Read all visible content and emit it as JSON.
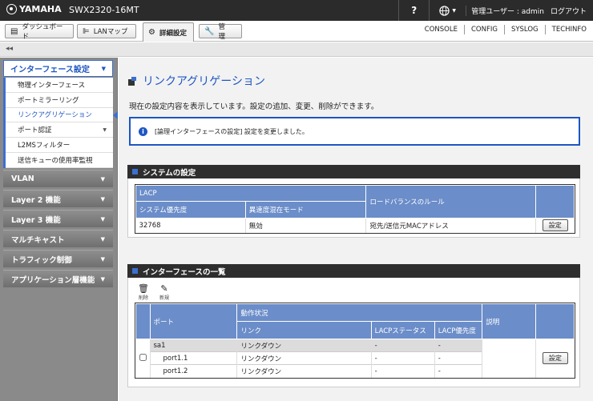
{
  "header": {
    "brand": "YAMAHA",
    "model": "SWX2320-16MT",
    "help": "?",
    "user": "管理ユーザー : admin",
    "logout": "ログアウト"
  },
  "nav": {
    "tabs": [
      {
        "label": "ダッシュボード",
        "icon": "dashboard-icon"
      },
      {
        "label": "LANマップ",
        "icon": "lanmap-icon"
      },
      {
        "label": "詳細設定",
        "icon": "gear-icon"
      },
      {
        "label": "管　理",
        "icon": "wrench-icon"
      }
    ],
    "links": [
      "CONSOLE",
      "CONFIG",
      "SYSLOG",
      "TECHINFO"
    ],
    "collapse": "◂◂"
  },
  "sidebar": {
    "section": "インターフェース設定",
    "items": [
      {
        "label": "物理インターフェース"
      },
      {
        "label": "ポートミラーリング"
      },
      {
        "label": "リンクアグリゲーション"
      },
      {
        "label": "ポート認証"
      },
      {
        "label": "L2MSフィルター"
      },
      {
        "label": "送信キューの使用率監視"
      }
    ],
    "groups": [
      "VLAN",
      "Layer 2 機能",
      "Layer 3 機能",
      "マルチキャスト",
      "トラフィック制御",
      "アプリケーション層機能"
    ]
  },
  "main": {
    "title": "リンクアグリゲーション",
    "description": "現在の設定内容を表示しています。設定の追加、変更、削除ができます。",
    "notice": "[論理インターフェースの設定] 設定を変更しました。",
    "system": {
      "heading": "システムの設定",
      "h_lacp": "LACP",
      "h_priority": "システム優先度",
      "h_mixed": "異速度混在モード",
      "h_lb": "ロードバランスのルール",
      "priority": "32768",
      "mixed": "無効",
      "lb": "宛先/送信元MACアドレス",
      "set_label": "設定"
    },
    "iflist": {
      "heading": "インターフェースの一覧",
      "delete_label": "削除",
      "new_label": "新規",
      "h_port": "ポート",
      "h_status": "動作状況",
      "h_link": "リンク",
      "h_lacp_status": "LACPステータス",
      "h_lacp_prio": "LACP優先度",
      "h_desc": "説明",
      "set_label": "設定",
      "rows": [
        {
          "port": "sa1",
          "link": "リンクダウン",
          "lacp_status": "-",
          "lacp_prio": "-",
          "desc": ""
        },
        {
          "port": "port1.1",
          "link": "リンクダウン",
          "lacp_status": "-",
          "lacp_prio": "-",
          "desc": ""
        },
        {
          "port": "port1.2",
          "link": "リンクダウン",
          "lacp_status": "-",
          "lacp_prio": "-",
          "desc": ""
        }
      ]
    }
  }
}
